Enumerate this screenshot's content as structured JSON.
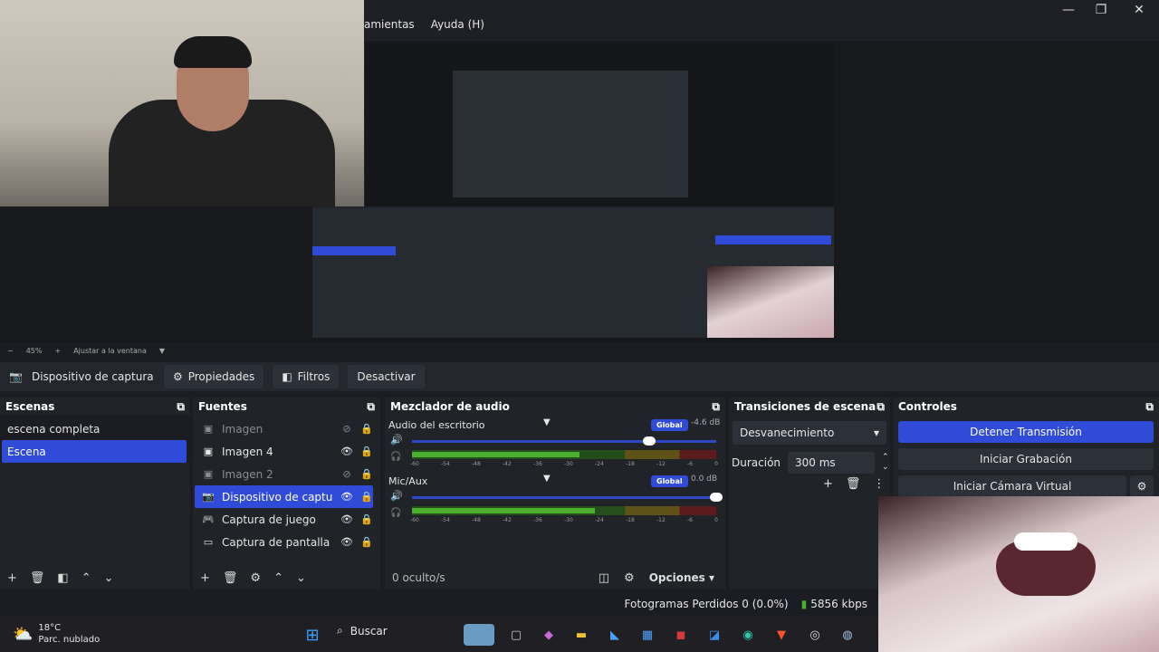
{
  "menu": [
    "amientas",
    "Ayuda (H)"
  ],
  "zoom": {
    "level": "45%",
    "fit_label": "Ajustar a la ventana"
  },
  "source_toolbar": {
    "source_name": "Dispositivo de captura de v",
    "properties": "Propiedades",
    "filters": "Filtros",
    "deactivate": "Desactivar"
  },
  "scenes": {
    "title": "Escenas",
    "items": [
      {
        "label": "escena completa"
      },
      {
        "label": "Escena"
      }
    ]
  },
  "sources": {
    "title": "Fuentes",
    "items": [
      {
        "label": "Imagen",
        "icon": "image-icon",
        "hidden": true
      },
      {
        "label": "Imagen 4",
        "icon": "image-icon",
        "hidden": false
      },
      {
        "label": "Imagen 2",
        "icon": "image-icon",
        "hidden": true
      },
      {
        "label": "Dispositivo de captura d",
        "icon": "camera-icon",
        "hidden": false
      },
      {
        "label": "Captura de juego",
        "icon": "gamepad-icon",
        "hidden": false
      },
      {
        "label": "Captura de pantalla",
        "icon": "monitor-icon",
        "hidden": false
      }
    ]
  },
  "mixer": {
    "title": "Mezclador de audio",
    "channels": [
      {
        "name": "Audio del escritorio",
        "db": "-4.6 dB",
        "global": "Global",
        "volume": 0.78,
        "level": 0.55
      },
      {
        "name": "Mic/Aux",
        "db": "0.0 dB",
        "global": "Global",
        "volume": 1.0,
        "level": 0.6
      }
    ],
    "scale": [
      "-60",
      "-54",
      "-48",
      "-42",
      "-36",
      "-30",
      "-24",
      "-18",
      "-12",
      "-6",
      "0"
    ],
    "hidden_count": "0 oculto/s",
    "options": "Opciones"
  },
  "transitions": {
    "title": "Transiciones de escena",
    "selected": "Desvanecimiento",
    "duration_label": "Duración",
    "duration_value": "300 ms"
  },
  "controls": {
    "title": "Controles",
    "stop_stream": "Detener Transmisión",
    "start_recording": "Iniciar Grabación",
    "virtual_cam": "Iniciar Cámara Virtual"
  },
  "status": {
    "dropped": "Fotogramas Perdidos 0 (0.0%)",
    "bitrate": "5856 kbps"
  },
  "weather": {
    "temp": "18°C",
    "desc": "Parc. nublado"
  },
  "taskbar": {
    "search": "Buscar"
  },
  "colors": {
    "accent": "#2f4bd8",
    "meter_green": "#4caf2f",
    "meter_yellow": "#b8a027",
    "meter_red": "#b8262b"
  }
}
